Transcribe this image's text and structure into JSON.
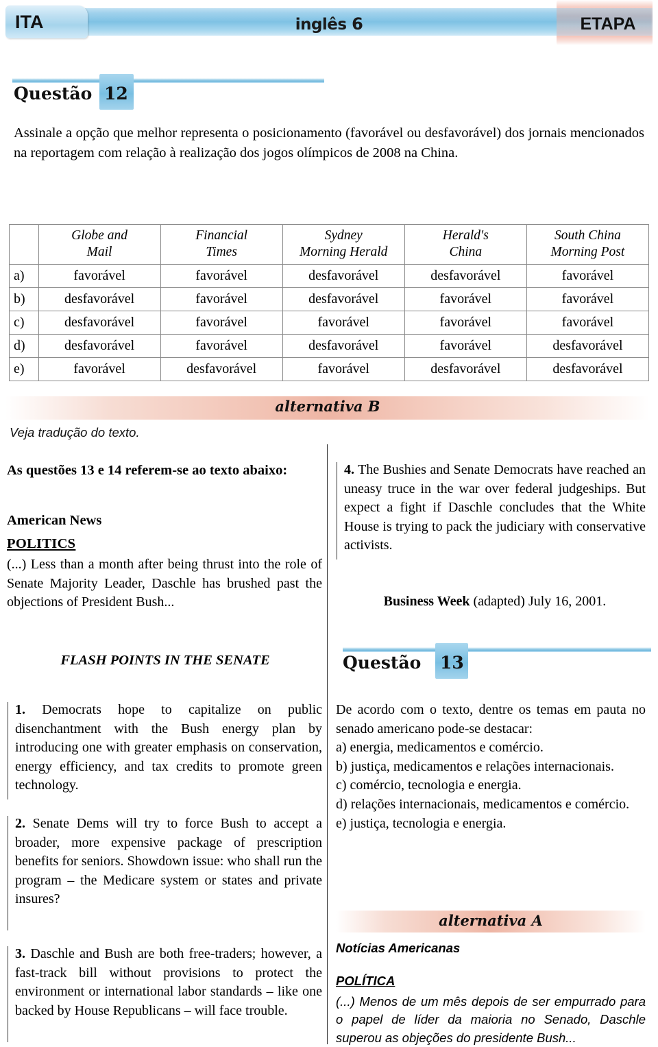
{
  "header": {
    "left_tab": "ITA",
    "title": "inglês",
    "title_number": "6",
    "right_logo": "ETAPA"
  },
  "question12": {
    "label": "Questão",
    "number": "12",
    "statement": "Assinale a opção que melhor representa o posicionamento (favorável ou desfavorável) dos jornais mencionados na reportagem com relação à realização dos jogos olímpicos de 2008 na China.",
    "table": {
      "corner": "",
      "columns": [
        "Globe and Mail",
        "Financial Times",
        "Sydney Morning Herald",
        "Herald's China",
        "South China Morning Post"
      ],
      "columns_lines": [
        [
          "Globe and",
          "Mail"
        ],
        [
          "Financial",
          "Times"
        ],
        [
          "Sydney",
          "Morning Herald"
        ],
        [
          "Herald's",
          "China"
        ],
        [
          "South China",
          "Morning Post"
        ]
      ],
      "rows": [
        {
          "label": "a)",
          "cells": [
            "favorável",
            "favorável",
            "desfavorável",
            "desfavorável",
            "favorável"
          ]
        },
        {
          "label": "b)",
          "cells": [
            "desfavorável",
            "favorável",
            "desfavorável",
            "favorável",
            "favorável"
          ]
        },
        {
          "label": "c)",
          "cells": [
            "desfavorável",
            "favorável",
            "favorável",
            "favorável",
            "favorável"
          ]
        },
        {
          "label": "d)",
          "cells": [
            "desfavorável",
            "favorável",
            "desfavorável",
            "favorável",
            "desfavorável"
          ]
        },
        {
          "label": "e)",
          "cells": [
            "favorável",
            "desfavorável",
            "favorável",
            "desfavorável",
            "desfavorável"
          ]
        }
      ]
    },
    "answer_banner": "alternativa B"
  },
  "translation_note": "Veja tradução do texto.",
  "text_intro": {
    "reference": "As questões 13 e 14 referem-se ao texto abaixo:",
    "source_title": "American News",
    "section": "POLITICS",
    "lead": "(...) Less than a month after being thrust into the role of Senate Majority Leader, Daschle has brushed past the objections of President Bush...",
    "flash_title": "FLASH POINTS IN THE SENATE",
    "items": [
      {
        "number": "1.",
        "text": "Democrats hope to capitalize on public disenchantment with the Bush energy plan by introducing one with greater emphasis on conservation, energy efficiency, and tax credits to promote green technology."
      },
      {
        "number": "2.",
        "text": "Senate Dems will try to force Bush to accept a broader, more expensive package of prescription benefits for seniors. Showdown issue: who shall run the program – the Medicare system or states and private insures?"
      },
      {
        "number": "3.",
        "text": "Daschle and Bush are both free-traders; however, a fast-track bill without provisions to protect the environment or international labor standards – like one backed by House Republicans – will face trouble."
      },
      {
        "number": "4.",
        "text": "The Bushies and Senate Democrats have reached an uneasy truce in the war over federal judgeships. But expect a fight if Daschle concludes that the White House is trying to pack the judiciary with conservative activists."
      }
    ],
    "credit_bold": "Business Week",
    "credit_rest": " (adapted) July 16, 2001."
  },
  "question13": {
    "label": "Questão",
    "number": "13",
    "stem": "De acordo com o texto, dentre os temas em pauta no senado americano pode-se destacar:",
    "options": [
      "a) energia, medicamentos e comércio.",
      "b) justiça, medicamentos e relações internacionais.",
      "c) comércio, tecnologia e energia.",
      "d) relações internacionais, medicamentos e comércio.",
      "e) justiça, tecnologia e energia."
    ],
    "answer_banner": "alternativa A"
  },
  "translation_block": {
    "source_title": "Notícias Americanas",
    "section": "POLÍTICA",
    "body": "(...) Menos de um mês depois de ser empurrado para o papel de líder da maioria no Senado, Daschle superou as objeções do presidente Bush..."
  }
}
